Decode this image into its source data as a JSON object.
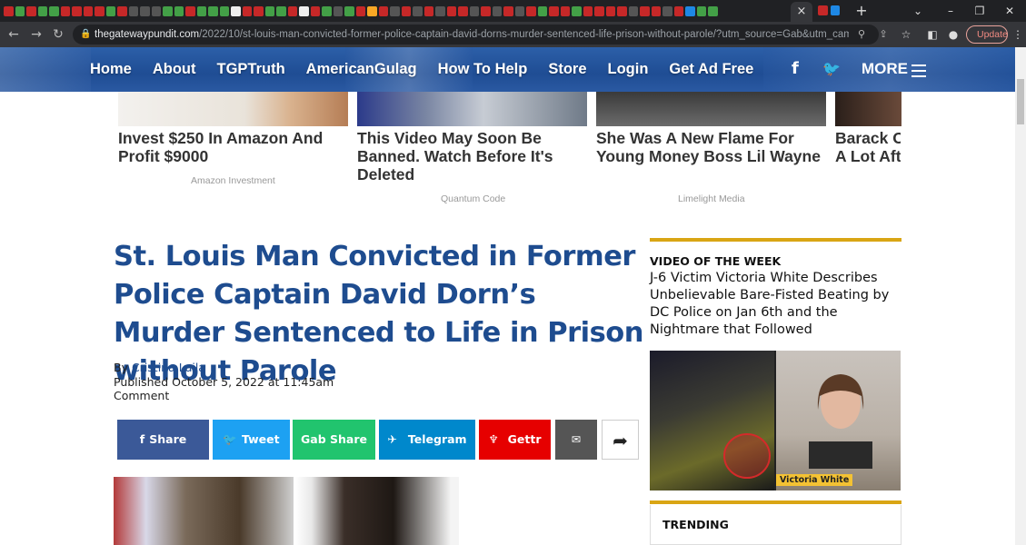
{
  "browser": {
    "url_host": "thegatewaypundit.com",
    "url_path": "/2022/10/st-louis-man-convicted-former-police-captain-david-dorns-murder-sentenced-life-prison-without-parole/?utm_source=Gab&utm_campaign=websi...",
    "update_label": "Update",
    "new_tab": "+",
    "active_tab_close": "×"
  },
  "site_nav": {
    "links": [
      "Home",
      "About",
      "TGPTruth",
      "AmericanGulag",
      "How To Help",
      "Store",
      "Login",
      "Get Ad Free"
    ],
    "facebook": "f",
    "twitter": "🐦",
    "more_label": "MORE"
  },
  "ads": [
    {
      "title": "Invest $250 In Amazon And Profit $9000",
      "source": "Amazon Investment"
    },
    {
      "title": "This Video May Soon Be Banned. Watch Before It's Deleted",
      "source": "Quantum Code"
    },
    {
      "title": "She Was A New Flame For Young Money Boss Lil Wayne",
      "source": "Limelight Media"
    },
    {
      "title": "Barack O A Lot Aft",
      "source": ""
    }
  ],
  "article": {
    "headline": "St. Louis Man Convicted in Former Police Captain David Dorn’s Murder Sentenced to Life in Prison without Parole",
    "by_prefix": "By ",
    "author": "Cristina Laila",
    "published": "Published October 5, 2022 at 11:45am",
    "comment_label": "Comment"
  },
  "share_buttons": [
    {
      "label": "Share",
      "icon": "f",
      "color": "#3b5998"
    },
    {
      "label": "Tweet",
      "icon": "🐦",
      "color": "#1da1f2"
    },
    {
      "label": "Gab Share",
      "icon": "",
      "color": "#21c46e"
    },
    {
      "label": "Telegram",
      "icon": "✈",
      "color": "#0088cc"
    },
    {
      "label": "Gettr",
      "icon": "♆",
      "color": "#e60000"
    },
    {
      "label": "",
      "icon": "✉",
      "color": "#555555"
    },
    {
      "label": "",
      "icon": "➦",
      "color": "#ffffff"
    }
  ],
  "sidebar": {
    "video_label": "VIDEO OF THE WEEK",
    "video_title": "J-6 Victim Victoria White Describes Unbelievable Bare-Fisted Beating by DC Police on Jan 6th and the Nightmare that Followed",
    "video_caption": "Victoria White",
    "trending_label": "TRENDING"
  },
  "colors": {
    "headline_blue": "#1e4c8f",
    "gold_accent": "#d9a514",
    "nav_blue": "#1f4d94"
  }
}
